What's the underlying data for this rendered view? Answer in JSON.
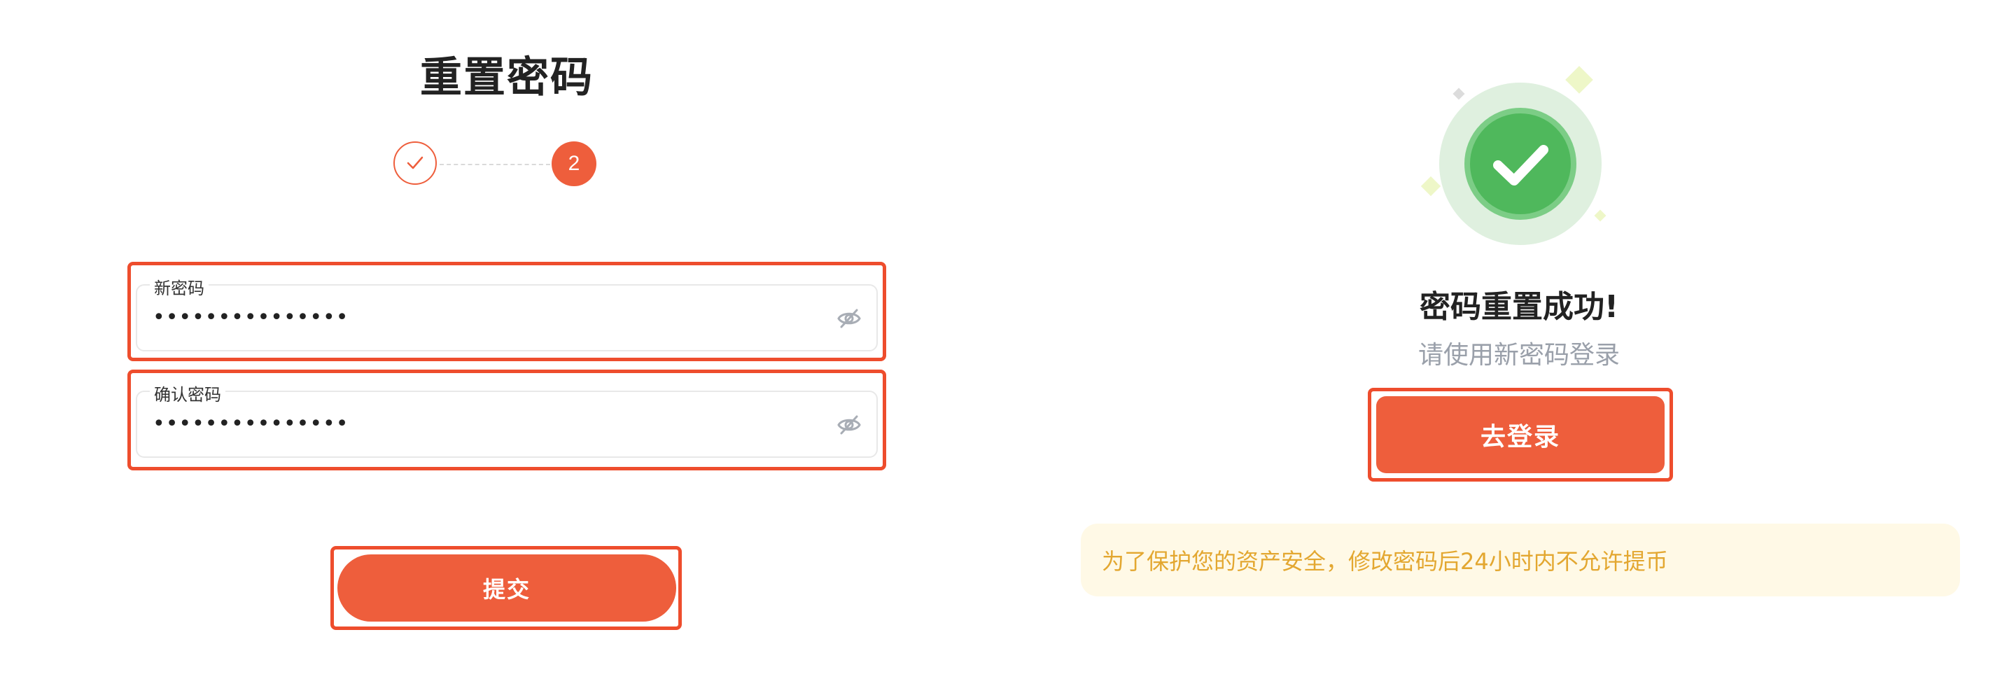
{
  "reset_form": {
    "title": "重置密码",
    "stepper": {
      "step2_label": "2"
    },
    "new_password": {
      "label": "新密码",
      "value": "•••••••••••••••"
    },
    "confirm_password": {
      "label": "确认密码",
      "value": "•••••••••••••••"
    },
    "submit_label": "提交"
  },
  "success_panel": {
    "title": "密码重置成功!",
    "subtitle": "请使用新密码登录",
    "login_button_label": "去登录",
    "notice": "为了保护您的资产安全，修改密码后24小时内不允许提币"
  },
  "colors": {
    "accent": "#ee5e3c",
    "highlight_border": "#ee4d2d",
    "success_green": "#5cbb6a",
    "notice_bg": "#fff9e6",
    "notice_text": "#e3a730"
  },
  "icons": {
    "step_done": "check-icon",
    "password_toggle": "eye-off-icon",
    "success": "check-circle-icon"
  }
}
